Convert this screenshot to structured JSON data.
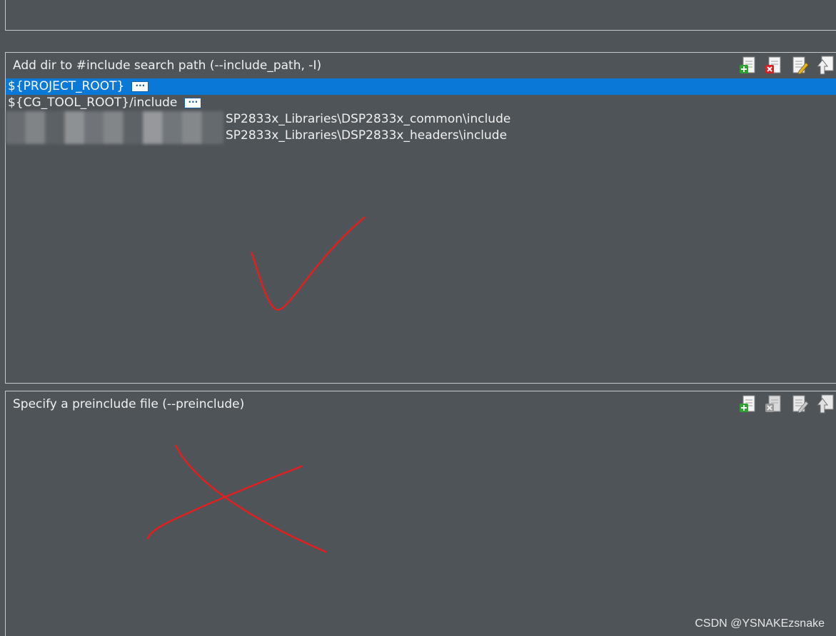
{
  "include_panel": {
    "title": "Add dir to #include search path (--include_path, -I)",
    "items": [
      {
        "label": "${PROJECT_ROOT}",
        "selected": true,
        "has_browse": true
      },
      {
        "label": "${CG_TOOL_ROOT}/include",
        "selected": false,
        "has_browse": true
      },
      {
        "label": "SP2833x_Libraries\\DSP2833x_common\\include",
        "selected": false,
        "has_browse": false,
        "obscured_prefix": true
      },
      {
        "label": "SP2833x_Libraries\\DSP2833x_headers\\include",
        "selected": false,
        "has_browse": false,
        "obscured_prefix": true
      }
    ],
    "browse_label": "···"
  },
  "preinclude_panel": {
    "title": "Specify a preinclude file (--preinclude)"
  },
  "toolbar_icons": [
    "add-file-icon",
    "delete-file-icon",
    "edit-file-icon",
    "move-up-icon"
  ],
  "annotations": {
    "check_color": "#e02020",
    "cross_color": "#e02020"
  },
  "watermark": "CSDN @YSNAKEzsnake"
}
